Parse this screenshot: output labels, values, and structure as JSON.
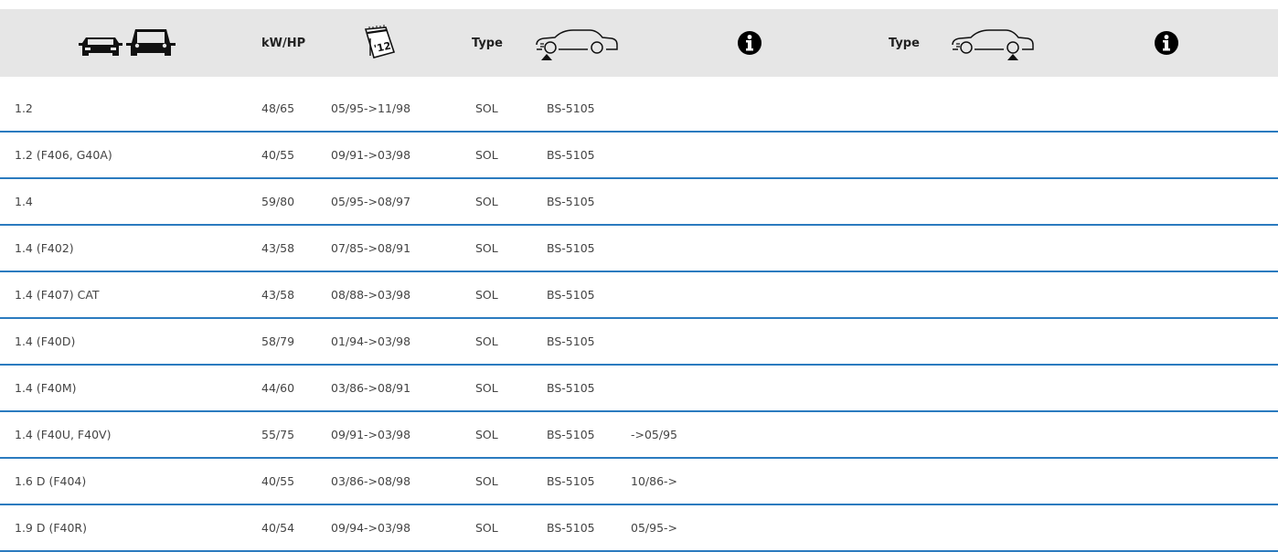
{
  "header": {
    "kw_label": "kW/HP",
    "type_label_1": "Type",
    "type_label_2": "Type",
    "icons": {
      "vehicles": "two-cars-icon",
      "calendar": "calendar-icon",
      "calendar_text": "'12",
      "front_axle": "car-front-axle-icon",
      "info_1": "info-icon",
      "rear_axle": "car-rear-axle-icon",
      "info_2": "info-icon"
    }
  },
  "rows": [
    {
      "engine": "1.2",
      "kw_hp": "48/65",
      "date": "05/95->11/98",
      "type": "SOL",
      "ref": "BS-5105",
      "info": ""
    },
    {
      "engine": "1.2 (F406, G40A)",
      "kw_hp": "40/55",
      "date": "09/91->03/98",
      "type": "SOL",
      "ref": "BS-5105",
      "info": ""
    },
    {
      "engine": "1.4",
      "kw_hp": "59/80",
      "date": "05/95->08/97",
      "type": "SOL",
      "ref": "BS-5105",
      "info": ""
    },
    {
      "engine": "1.4 (F402)",
      "kw_hp": "43/58",
      "date": "07/85->08/91",
      "type": "SOL",
      "ref": "BS-5105",
      "info": ""
    },
    {
      "engine": "1.4 (F407) CAT",
      "kw_hp": "43/58",
      "date": "08/88->03/98",
      "type": "SOL",
      "ref": "BS-5105",
      "info": ""
    },
    {
      "engine": "1.4 (F40D)",
      "kw_hp": "58/79",
      "date": "01/94->03/98",
      "type": "SOL",
      "ref": "BS-5105",
      "info": ""
    },
    {
      "engine": "1.4 (F40M)",
      "kw_hp": "44/60",
      "date": "03/86->08/91",
      "type": "SOL",
      "ref": "BS-5105",
      "info": ""
    },
    {
      "engine": "1.4 (F40U, F40V)",
      "kw_hp": "55/75",
      "date": "09/91->03/98",
      "type": "SOL",
      "ref": "BS-5105",
      "info": "->05/95"
    },
    {
      "engine": "1.6 D (F404)",
      "kw_hp": "40/55",
      "date": "03/86->08/98",
      "type": "SOL",
      "ref": "BS-5105",
      "info": "10/86->"
    },
    {
      "engine": "1.9 D (F40R)",
      "kw_hp": "40/54",
      "date": "09/94->03/98",
      "type": "SOL",
      "ref": "BS-5105",
      "info": "05/95->"
    }
  ]
}
